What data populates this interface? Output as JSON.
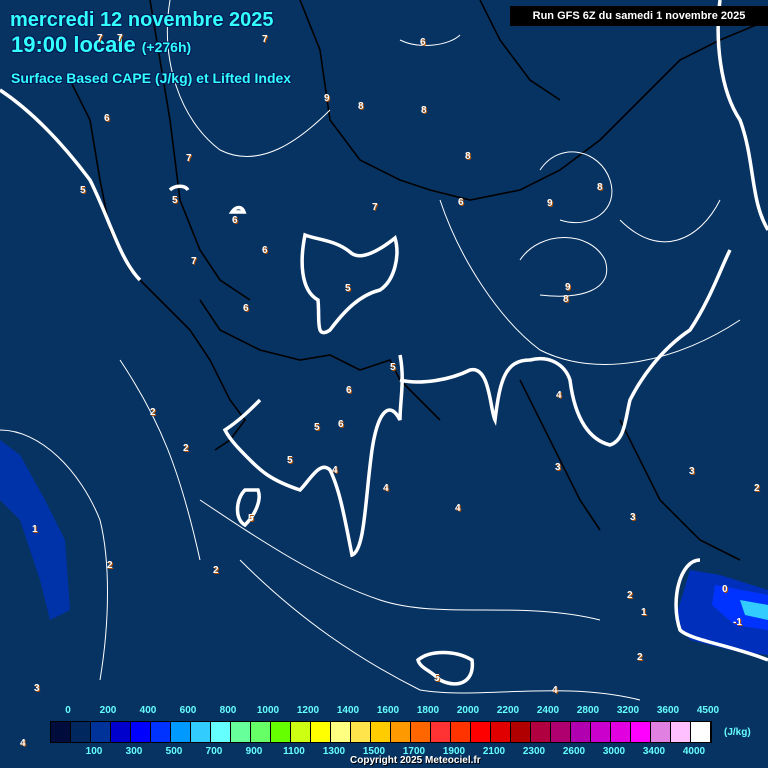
{
  "header": {
    "date": "mercredi 12 novembre 2025",
    "time": "19:00 locale",
    "lead": "(+276h)",
    "parameter": "Surface Based CAPE (J/kg) et Lifted Index",
    "run": "Run GFS 6Z du samedi 1 novembre 2025"
  },
  "contour_labels": [
    "7",
    "7",
    "7",
    "6",
    "9",
    "8",
    "8",
    "6",
    "8",
    "7",
    "5",
    "5",
    "6",
    "7",
    "6",
    "6",
    "7",
    "9",
    "8",
    "9",
    "8",
    "5",
    "5",
    "6",
    "4",
    "2",
    "2",
    "5",
    "6",
    "6",
    "5",
    "4",
    "4",
    "3",
    "2",
    "3",
    "5",
    "4",
    "1",
    "2",
    "2",
    "3",
    "2",
    "1",
    "2",
    "0",
    "-1",
    "5",
    "3",
    "4",
    "4"
  ],
  "legend": {
    "colors": [
      "#000c3c",
      "#00275e",
      "#003399",
      "#0000cc",
      "#0000ff",
      "#0033ff",
      "#0099ff",
      "#33ccff",
      "#66ffff",
      "#66ff99",
      "#66ff66",
      "#66ff00",
      "#ccff11",
      "#ffff00",
      "#ffff80",
      "#ffe44c",
      "#ffcc00",
      "#ff9900",
      "#ff6600",
      "#ff3333",
      "#ff3300",
      "#ff0000",
      "#e00000",
      "#b00000",
      "#b00040",
      "#b00070",
      "#b000b0",
      "#cc00cc",
      "#e000e0",
      "#ff00ff",
      "#e080e0",
      "#ffc0ff",
      "#ffffff"
    ],
    "top_labels": [
      "0",
      "200",
      "400",
      "600",
      "800",
      "1000",
      "1200",
      "1400",
      "1600",
      "1800",
      "2000",
      "2200",
      "2400",
      "2800",
      "3200",
      "3600",
      "4500"
    ],
    "bottom_labels": [
      "100",
      "300",
      "500",
      "700",
      "900",
      "1100",
      "1300",
      "1500",
      "1700",
      "1900",
      "2100",
      "2300",
      "2600",
      "3000",
      "3400",
      "4000"
    ],
    "unit": "(J/kg)"
  },
  "copyright": "Copyright 2025 Meteociel.fr"
}
